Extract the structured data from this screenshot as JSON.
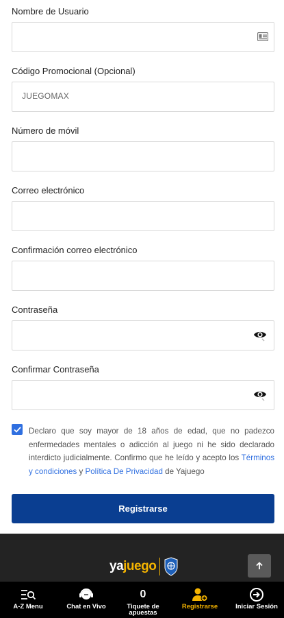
{
  "form": {
    "username": {
      "label": "Nombre de Usuario",
      "value": ""
    },
    "promo": {
      "label": "Código Promocional (Opcional)",
      "value": "JUEGOMAX"
    },
    "mobile": {
      "label": "Número de móvil",
      "value": ""
    },
    "email": {
      "label": "Correo electrónico",
      "value": ""
    },
    "email_confirm": {
      "label": "Confirmación correo electrónico",
      "value": ""
    },
    "password": {
      "label": "Contraseña",
      "value": ""
    },
    "password_confirm": {
      "label": "Confirmar Contraseña",
      "value": ""
    }
  },
  "consent": {
    "checked": true,
    "text_before": "Declaro que soy mayor de 18 años de edad, que no padezco enfermedades mentales o adicción al juego ni he sido declarado interdicto judicialmente. Confirmo que he leído y acepto los ",
    "terms_link": "Términos y condiciones",
    "and": " y ",
    "privacy_link": "Política De Privacidad",
    "text_after": " de Yajuego"
  },
  "submit_label": "Registrarse",
  "footer": {
    "logo_ya": "ya",
    "logo_juego": "juego"
  },
  "colors": {
    "accent": "#2f6fe0",
    "primary": "#0a3e91",
    "brand_yellow": "#f5b400",
    "footer_bg": "#232323",
    "nav_bg": "#000000"
  },
  "bottom_nav": {
    "az_menu": "A-Z Menu",
    "live_chat": "Chat en Vivo",
    "bet_slip_count": "0",
    "bet_slip": "Tiquete de apuestas",
    "register": "Registrarse",
    "login": "Iniciar Sesión"
  }
}
